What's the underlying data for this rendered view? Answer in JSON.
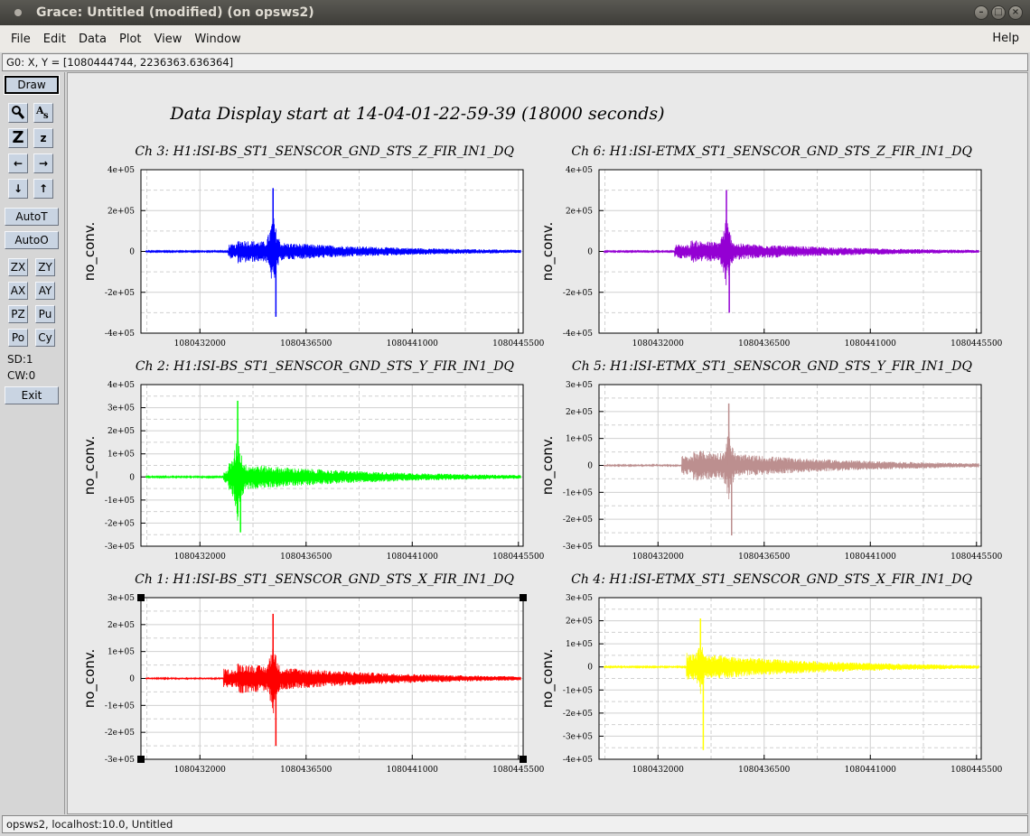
{
  "window": {
    "title": "Grace: Untitled (modified) (on opsws2)"
  },
  "menubar": {
    "items": [
      "File",
      "Edit",
      "Data",
      "Plot",
      "View",
      "Window"
    ],
    "help": "Help"
  },
  "locator": {
    "text": "G0: X, Y = [1080444744, 2236363.636364]"
  },
  "toolbar": {
    "draw": "Draw",
    "zoom_icon": "magnifier-icon",
    "text_icon": "text-icon",
    "zoom_Z": "Z",
    "zoom_z": "z",
    "arrows": [
      "←",
      "→",
      "↓",
      "↑"
    ],
    "autot": "AutoT",
    "autoo": "AutoO",
    "zx": "ZX",
    "zy": "ZY",
    "ax": "AX",
    "ay": "AY",
    "pz": "PZ",
    "pu": "Pu",
    "po": "Po",
    "cy": "Cy",
    "sd": "SD:1",
    "cw": "CW:0",
    "exit": "Exit"
  },
  "status": {
    "text": "opsws2, localhost:10.0, Untitled"
  },
  "chart_title": "Data Display start at 14-04-01-22-59-39 (18000 seconds)",
  "chart_data": [
    {
      "type": "line",
      "title": "Ch 3: H1:ISI-BS_ST1_SENSCOR_GND_STS_Z_FIR_IN1_DQ",
      "ylabel": "no_conv.",
      "color": "#0000ff",
      "xlim": [
        1080429500,
        1080445700
      ],
      "ylim": [
        -400000,
        400000
      ],
      "xticks": [
        "1080432000",
        "1080436500",
        "1080441000",
        "1080445500"
      ],
      "yticks": [
        "4e+05",
        "2e+05",
        "0",
        "-2e+05",
        "-4e+05"
      ],
      "grid": true,
      "envelope": {
        "onset_x": 1080433200,
        "peak_x": 1080435100,
        "peak_hi": 310000,
        "peak_lo": -320000,
        "noise": 3000,
        "end_x": 1080445500
      }
    },
    {
      "type": "line",
      "title": "Ch 6: H1:ISI-ETMX_ST1_SENSCOR_GND_STS_Z_FIR_IN1_DQ",
      "ylabel": "no_conv.",
      "color": "#9400d3",
      "xlim": [
        1080429500,
        1080445700
      ],
      "ylim": [
        -400000,
        400000
      ],
      "xticks": [
        "1080432000",
        "1080436500",
        "1080441000",
        "1080445500"
      ],
      "yticks": [
        "4e+05",
        "2e+05",
        "0",
        "-2e+05",
        "-4e+05"
      ],
      "grid": true,
      "envelope": {
        "onset_x": 1080432700,
        "peak_x": 1080434900,
        "peak_hi": 300000,
        "peak_lo": -300000,
        "noise": 3000,
        "end_x": 1080445500
      }
    },
    {
      "type": "line",
      "title": "Ch 2: H1:ISI-BS_ST1_SENSCOR_GND_STS_Y_FIR_IN1_DQ",
      "ylabel": "no_conv.",
      "color": "#00ff00",
      "xlim": [
        1080429500,
        1080445700
      ],
      "ylim": [
        -300000,
        400000
      ],
      "xticks": [
        "1080432000",
        "1080436500",
        "1080441000",
        "1080445500"
      ],
      "yticks": [
        "4e+05",
        "3e+05",
        "2e+05",
        "1e+05",
        "0",
        "-1e+05",
        "-2e+05",
        "-3e+05"
      ],
      "grid": true,
      "envelope": {
        "onset_x": 1080433200,
        "peak_x": 1080433600,
        "peak_hi": 330000,
        "peak_lo": -240000,
        "noise": 3000,
        "end_x": 1080445500
      }
    },
    {
      "type": "line",
      "title": "Ch 5: H1:ISI-ETMX_ST1_SENSCOR_GND_STS_Y_FIR_IN1_DQ",
      "ylabel": "no_conv.",
      "color": "#bc8f8f",
      "xlim": [
        1080429500,
        1080445700
      ],
      "ylim": [
        -300000,
        300000
      ],
      "xticks": [
        "1080432000",
        "1080436500",
        "1080441000",
        "1080445500"
      ],
      "yticks": [
        "3e+05",
        "2e+05",
        "1e+05",
        "0",
        "-1e+05",
        "-2e+05",
        "-3e+05"
      ],
      "grid": true,
      "envelope": {
        "onset_x": 1080433000,
        "peak_x": 1080435000,
        "peak_hi": 230000,
        "peak_lo": -260000,
        "noise": 3000,
        "end_x": 1080445500
      }
    },
    {
      "type": "line",
      "title": "Ch 1: H1:ISI-BS_ST1_SENSCOR_GND_STS_X_FIR_IN1_DQ",
      "ylabel": "no_conv.",
      "color": "#ff0000",
      "xlim": [
        1080429500,
        1080445700
      ],
      "ylim": [
        -300000,
        300000
      ],
      "xticks": [
        "1080432000",
        "1080436500",
        "1080441000",
        "1080445500"
      ],
      "yticks": [
        "3e+05",
        "2e+05",
        "1e+05",
        "0",
        "-1e+05",
        "-2e+05",
        "-3e+05"
      ],
      "grid": true,
      "envelope": {
        "onset_x": 1080433000,
        "peak_x": 1080435100,
        "peak_hi": 240000,
        "peak_lo": -250000,
        "noise": 3000,
        "end_x": 1080445500
      }
    },
    {
      "type": "line",
      "title": "Ch 4: H1:ISI-ETMX_ST1_SENSCOR_GND_STS_X_FIR_IN1_DQ",
      "ylabel": "no_conv.",
      "color": "#ffff00",
      "xlim": [
        1080429500,
        1080445700
      ],
      "ylim": [
        -400000,
        300000
      ],
      "xticks": [
        "1080432000",
        "1080436500",
        "1080441000",
        "1080445500"
      ],
      "yticks": [
        "3e+05",
        "2e+05",
        "1e+05",
        "0",
        "-1e+05",
        "-2e+05",
        "-3e+05",
        "-4e+05"
      ],
      "grid": true,
      "envelope": {
        "onset_x": 1080433200,
        "peak_x": 1080433800,
        "peak_hi": 210000,
        "peak_lo": -360000,
        "noise": 3000,
        "end_x": 1080445500
      }
    }
  ]
}
